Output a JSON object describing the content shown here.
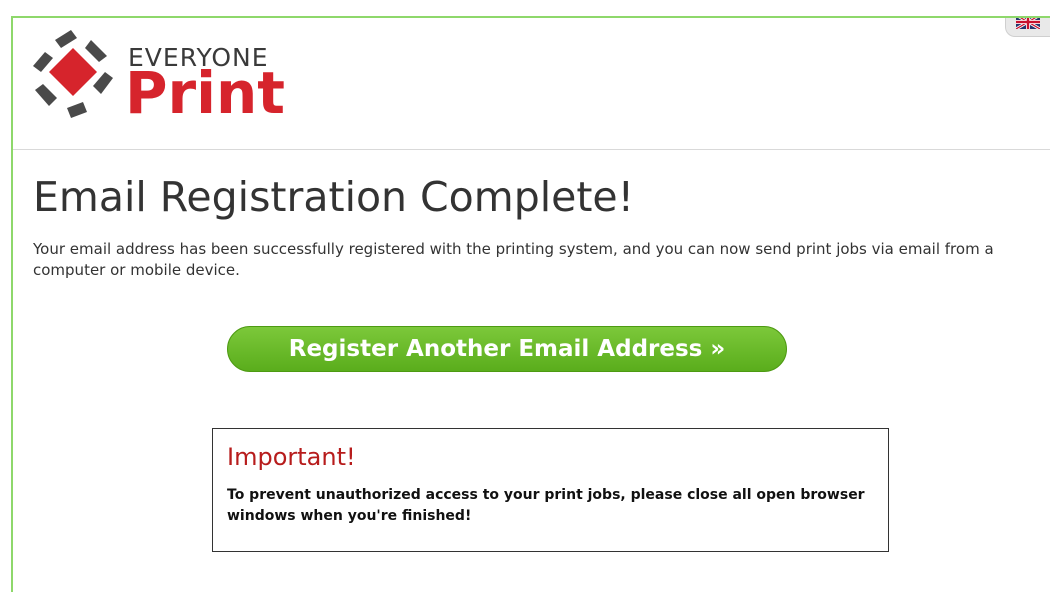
{
  "logo": {
    "line1": "EVERYONE",
    "line2": "Print",
    "brand_colors": {
      "red": "#d6242c",
      "dark": "#3a3a3a"
    }
  },
  "language_flag_icon": "uk-flag-icon",
  "page": {
    "title": "Email Registration Complete!",
    "message": "Your email address has been successfully registered with the printing system, and you can now send print jobs via email from a computer or mobile device."
  },
  "actions": {
    "register_another_label": "Register Another Email Address »",
    "accent_color": "#5aad1c"
  },
  "notice": {
    "heading": "Important!",
    "text": "To prevent unauthorized access to your print jobs, please close all open browser windows when you're finished!",
    "heading_color": "#b71c1c"
  }
}
